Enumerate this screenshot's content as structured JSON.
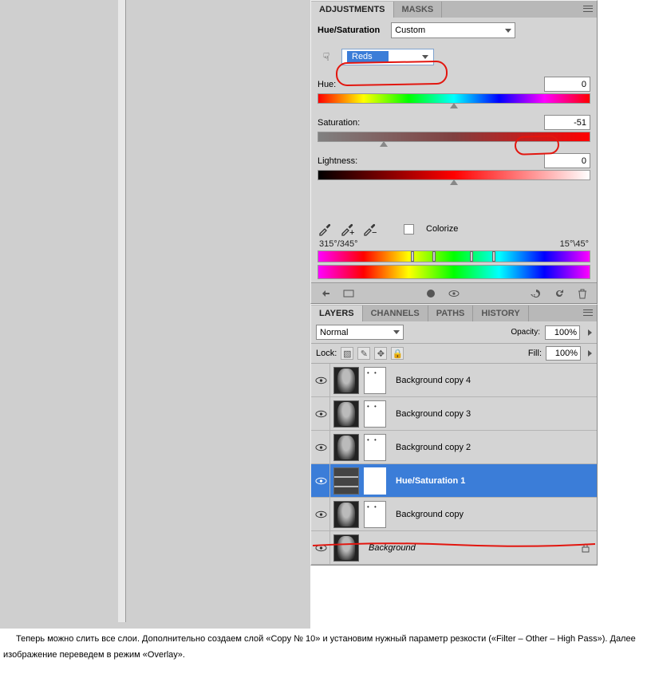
{
  "adjustments": {
    "tabs": [
      "ADJUSTMENTS",
      "MASKS"
    ],
    "title": "Hue/Saturation",
    "preset": "Custom",
    "channel": "Reds",
    "hue": {
      "label": "Hue:",
      "value": "0"
    },
    "saturation": {
      "label": "Saturation:",
      "value": "-51"
    },
    "lightness": {
      "label": "Lightness:",
      "value": "0"
    },
    "colorize": "Colorize",
    "range_left": "315°/345°",
    "range_right": "15°\\45°"
  },
  "layers": {
    "tabs": [
      "LAYERS",
      "CHANNELS",
      "PATHS",
      "HISTORY"
    ],
    "blend_mode": "Normal",
    "opacity_label": "Opacity:",
    "opacity": "100%",
    "lock_label": "Lock:",
    "fill_label": "Fill:",
    "fill": "100%",
    "items": [
      {
        "name": "Background copy 4"
      },
      {
        "name": "Background copy 3"
      },
      {
        "name": "Background copy 2"
      },
      {
        "name": "Hue/Saturation 1"
      },
      {
        "name": "Background copy"
      },
      {
        "name": "Background"
      }
    ]
  },
  "doc": "Теперь можно слить все слои. Дополнительно создаем слой «Copy № 10» и установим нужный параметр резкости («Filter – Other – High Pass»). Далее изображение переведем в режим «Overlay»."
}
